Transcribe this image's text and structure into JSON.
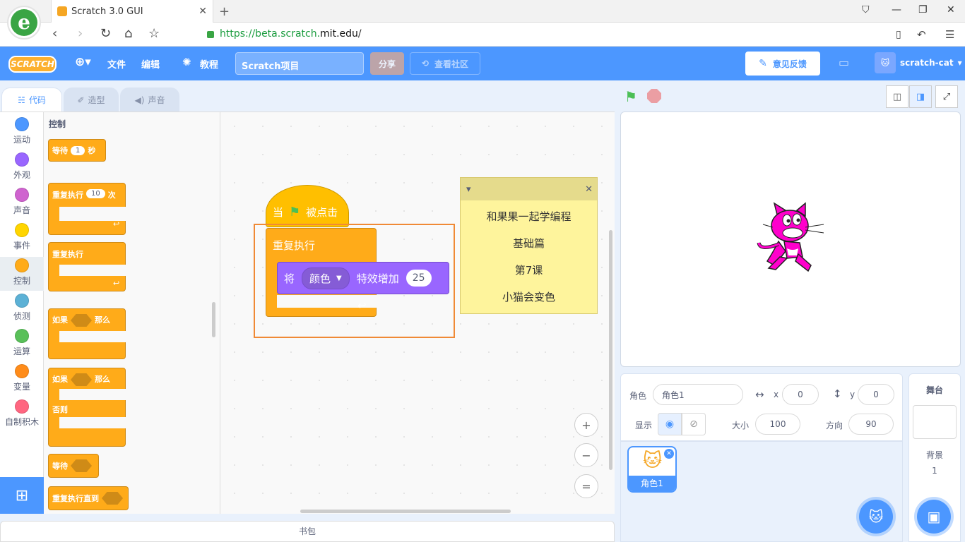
{
  "browser": {
    "tab_title": "Scratch 3.0 GUI",
    "url_prefix": "https://beta.scratch.",
    "url_domain": "mit.edu",
    "url_suffix": "/",
    "new_tab": "+",
    "close": "✕"
  },
  "menu": {
    "logo": "SCRATCH",
    "file": "文件",
    "edit": "编辑",
    "tutorials": "教程",
    "project_title": "Scratch项目",
    "share": "分享",
    "community": "查看社区",
    "feedback": "意见反馈",
    "username": "scratch-cat"
  },
  "editor_tabs": [
    "代码",
    "造型",
    "声音"
  ],
  "categories": [
    {
      "label": "运动",
      "color": "#4c97ff"
    },
    {
      "label": "外观",
      "color": "#9966ff"
    },
    {
      "label": "声音",
      "color": "#cf63cf"
    },
    {
      "label": "事件",
      "color": "#ffd500"
    },
    {
      "label": "控制",
      "color": "#ffab19"
    },
    {
      "label": "侦测",
      "color": "#5cb1d6"
    },
    {
      "label": "运算",
      "color": "#59c059"
    },
    {
      "label": "变量",
      "color": "#ff8c1a"
    },
    {
      "label": "自制积木",
      "color": "#ff6680"
    }
  ],
  "palette": {
    "heading": "控制",
    "wait_label": "等待",
    "wait_value": "1",
    "wait_unit": "秒",
    "repeat_label": "重复执行",
    "repeat_value": "10",
    "repeat_unit": "次",
    "forever_label": "重复执行",
    "if_label": "如果",
    "then_label": "那么",
    "else_label": "否则",
    "wait_until_label": "等待",
    "repeat_until_label": "重复执行直到"
  },
  "script": {
    "hat_when": "当",
    "hat_clicked": "被点击",
    "forever": "重复执行",
    "change_prefix": "将",
    "effect": "颜色",
    "change_suffix": "特效增加",
    "change_value": "25"
  },
  "note": {
    "lines": [
      "和果果一起学编程",
      "基础篇",
      "第7课",
      "小猫会变色"
    ]
  },
  "zoom": {
    "in": "+",
    "out": "−",
    "reset": "="
  },
  "backpack": "书包",
  "sprite_info": {
    "sprite_label": "角色",
    "sprite_name": "角色1",
    "x_label": "x",
    "x_value": "0",
    "y_label": "y",
    "y_value": "0",
    "show_label": "显示",
    "size_label": "大小",
    "size_value": "100",
    "direction_label": "方向",
    "direction_value": "90"
  },
  "sprites": [
    {
      "name": "角色1"
    }
  ],
  "stage_panel": {
    "title": "舞台",
    "backdrop_label": "背景",
    "backdrop_count": "1"
  },
  "colors": {
    "menu_blue": "#4c97ff",
    "control_orange": "#ffab19",
    "looks_purple": "#9966ff",
    "highlight": "#f08a36",
    "cat_magenta": "#ff00cc"
  }
}
